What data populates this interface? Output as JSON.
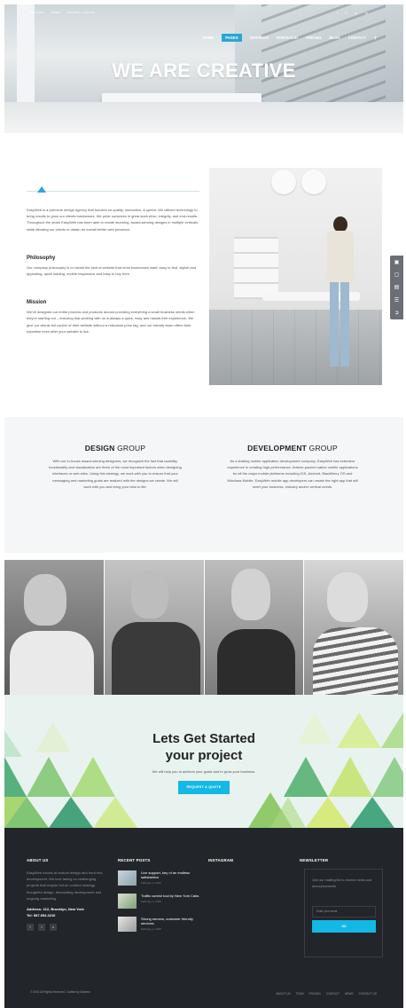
{
  "topbar": {
    "items": [
      "SERVICES",
      "ORDER",
      "REQUEST A QUOTE"
    ],
    "social": [
      "f",
      "t",
      "g",
      "in"
    ]
  },
  "nav": {
    "items": [
      "HOME",
      "PAGES",
      "SERVICES",
      "PORTFOLIO",
      "PRICING",
      "BLOG",
      "CONTACT"
    ],
    "active": "PAGES"
  },
  "hero": {
    "title": "WE ARE CREATIVE"
  },
  "about": {
    "intro": "EasyWeb is a premium design agency that focuses on quality, innovation, & speed. We utilized technology to bring results to grow our clients businesses. We pride ourselves in great work ethic, integrity, and end-results. Throughout the years EasyWeb has been able to create stunning, award-winning designs in multiple verticals while allowing our clients to obtain an overall better web presence.",
    "philosophy_title": "Philosophy",
    "philosophy_text": "Our company philosophy is to create the kind of website that most businesses want: easy to find, stylish and appealing, quick loading, mobile responsive and easy to buy from.",
    "mission_title": "Mission",
    "mission_text": "We've designed our entire process and products around providing everything a small business needs when they're starting out – ensuring that working with us is always a quick, easy and hassle-free experience. We give our clients full control of their website without a ridiculous price tag, and our friendly team offers their expertise even after your website is live."
  },
  "groups": {
    "design": {
      "title_bold": "DESIGN",
      "title_rest": " GROUP",
      "text": "With our in-house award-winning designers, we recognize the fact that usability, functionality and visualization are three of the most important factors when designing interfaces or web sites. Using this strategy, we work with you to ensure that your messaging and marketing goals are realized with the designs we create. We will work with you and bring your idea to life."
    },
    "development": {
      "title_bold": "DEVELOPMENT",
      "title_rest": " GROUP",
      "text": "As a leading mobile application development company, EasyWeb has extensive experience in creating high performance, feature-packed native mobile applications for all the major mobile platforms including iOS, Android, BlackBerry OS and Windows Mobile. EasyWeb mobile app developers can create the right app that will meet your business, industry and/or vertical needs."
    }
  },
  "cta": {
    "title_line1": "Lets Get Started",
    "title_line2": "your project",
    "subtitle": "We will help you to achieve your goals and to grow your business.",
    "button": "REQUEST A QUOTE"
  },
  "footer": {
    "about_title": "ABOUT US",
    "about_text": "EasyWeb excels at custom design and front end development. We love taking on challenging projects that require full-on content strategy, thoughtful design, demanding development and ongoing marketing.",
    "address": "Address: 212, Brooklyn, New York",
    "tel": "Tel: 987.654.3210",
    "social": [
      "f",
      "t",
      "o"
    ],
    "posts_title": "RECENT POSTS",
    "posts": [
      {
        "title": "Live support, key of an endless satisfaction",
        "date": "February 4, 2016"
      },
      {
        "title": "Traffic control tool by New York Cabs",
        "date": "February 4, 2016"
      },
      {
        "title": "Strong servers, customer friendly services",
        "date": "February 4, 2016"
      }
    ],
    "instagram_title": "INSTAGRAM",
    "newsletter_title": "NEWSLETTER",
    "newsletter_text": "Join our mailing list to receive news and announcements",
    "email_placeholder": "Enter your email",
    "go_label": "GO",
    "copyright": "© 2016 All Rights Reserved. Crafted by Mabrew",
    "links": [
      "ABOUT US",
      "TEAM",
      "PRICING",
      "CONTACT",
      "NEWS",
      "CONTACT US"
    ]
  }
}
